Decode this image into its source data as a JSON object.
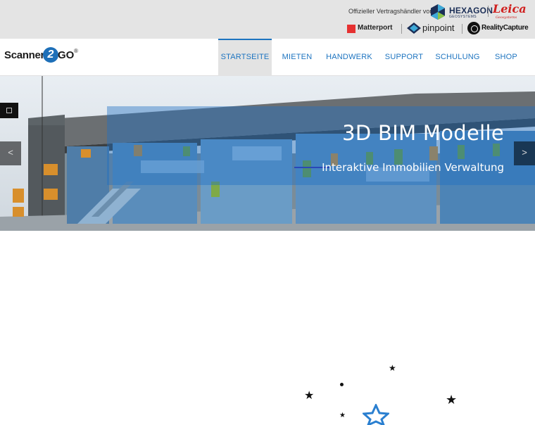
{
  "topbar": {
    "partner_label": "Offizieller Vertragshändler von:",
    "partners": {
      "hexagon": {
        "name": "HEXAGON",
        "sub": "GEOSYSTEMS"
      },
      "leica": {
        "name": "Leica",
        "sub": "Geosystems"
      },
      "matterport": {
        "name": "Matterport"
      },
      "pinpoint": {
        "name": "pinpoint"
      },
      "realitycapture": {
        "name": "RealityCapture"
      }
    }
  },
  "logo": {
    "part_a": "Scanner",
    "part_2": "2",
    "part_b": "GO",
    "reg": "®"
  },
  "nav": {
    "items": [
      {
        "label": "STARTSEITE",
        "active": true
      },
      {
        "label": "MIETEN"
      },
      {
        "label": "HANDWERK"
      },
      {
        "label": "SUPPORT"
      },
      {
        "label": "SCHULUNG"
      },
      {
        "label": "SHOP"
      }
    ]
  },
  "hero": {
    "title": "3D BIM Modelle",
    "subtitle": "Interaktive Immobilien Verwaltung",
    "prev": "<",
    "next": ">"
  },
  "decor": {
    "star": "★"
  },
  "colors": {
    "accent": "#1d74c0",
    "hero_overlay": "#1e6fc4",
    "leica_red": "#d0201f",
    "topbar_bg": "#e4e4e4"
  }
}
